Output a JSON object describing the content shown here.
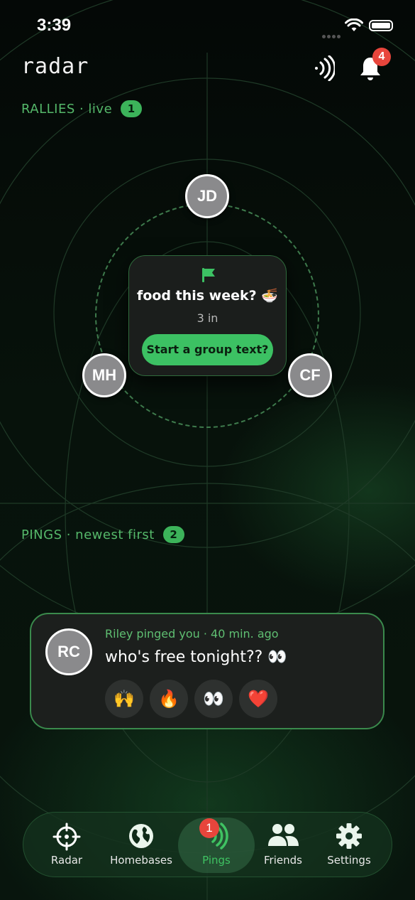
{
  "status_bar": {
    "time": "3:39"
  },
  "header": {
    "title": "radar",
    "notifications_count": "4"
  },
  "rallies": {
    "label": "RALLIES · live",
    "count": "1",
    "rally": {
      "title": "food this week? 🍜",
      "subtitle": "3 in",
      "action_label": "Start a group text?",
      "participants": [
        "JD",
        "MH",
        "CF"
      ]
    }
  },
  "pings": {
    "label": "PINGS · newest first",
    "count": "2",
    "items": [
      {
        "avatar": "RC",
        "meta": "Riley pinged you · 40 min. ago",
        "message": "who's free tonight?? 👀",
        "reactions": [
          "🙌",
          "🔥",
          "👀",
          "❤️"
        ]
      }
    ]
  },
  "tabbar": {
    "tabs": [
      {
        "label": "Radar",
        "icon": "crosshair-icon"
      },
      {
        "label": "Homebases",
        "icon": "globe-icon"
      },
      {
        "label": "Pings",
        "icon": "signal-waves-icon"
      },
      {
        "label": "Friends",
        "icon": "people-icon"
      },
      {
        "label": "Settings",
        "icon": "gear-icon"
      }
    ],
    "active_tab": "Pings",
    "pings_badge": "1"
  },
  "colors": {
    "accent": "#3cc163",
    "badge": "#e8453c",
    "background": "#050a07"
  }
}
